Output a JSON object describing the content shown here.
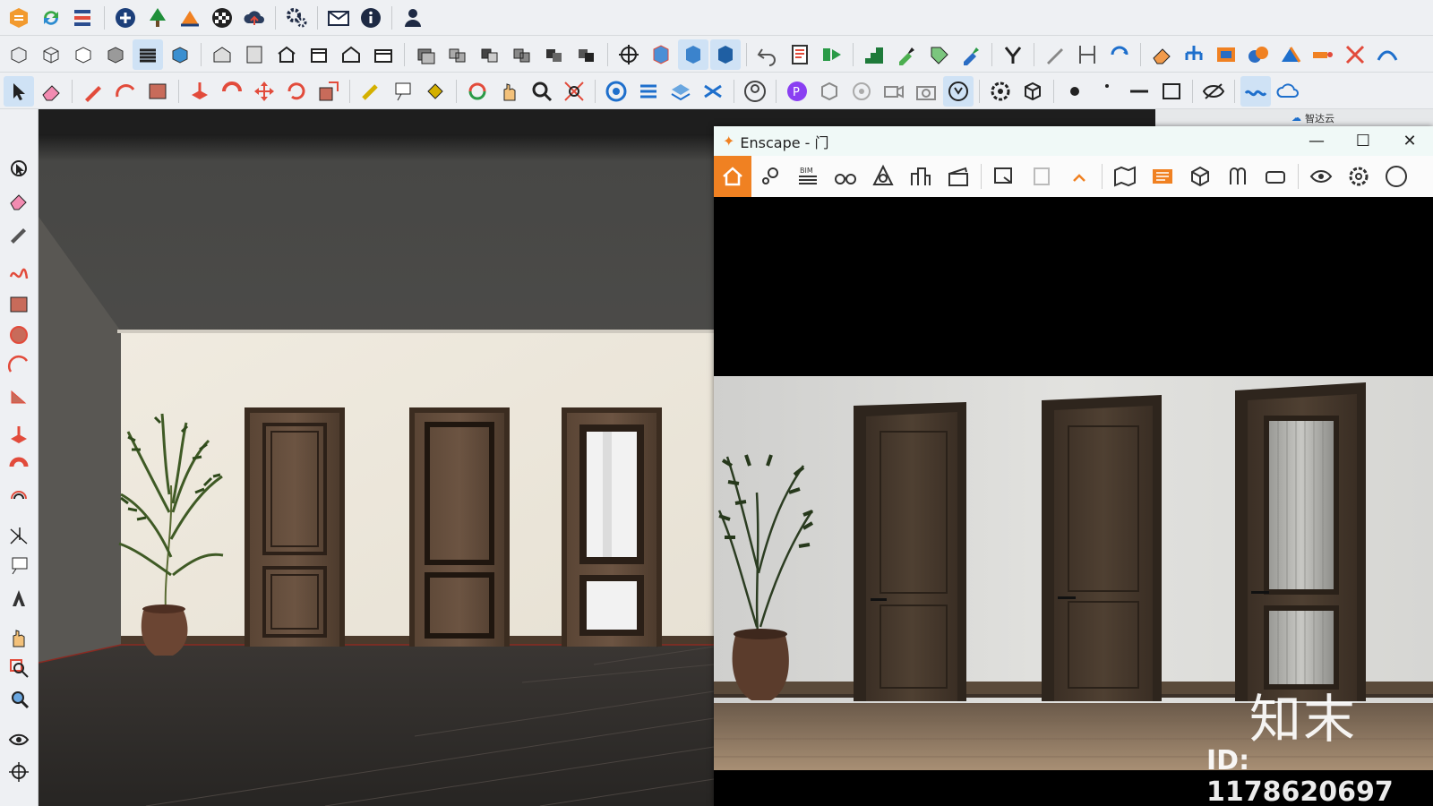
{
  "enscape_window": {
    "title": "Enscape - 门",
    "minimize": "—",
    "maximize": "☐",
    "close": "✕",
    "toolbar_label_bim": "BIM"
  },
  "side_panel": {
    "label": "智达云"
  },
  "watermark": {
    "logo_text": "知末",
    "id_text": "ID: 1178620697"
  },
  "colors": {
    "toolbar_bg": "#eef0f3",
    "enscape_accent": "#f08122",
    "viewport_wall": "#ede7dc",
    "door_wood": "#4b3a2c"
  }
}
